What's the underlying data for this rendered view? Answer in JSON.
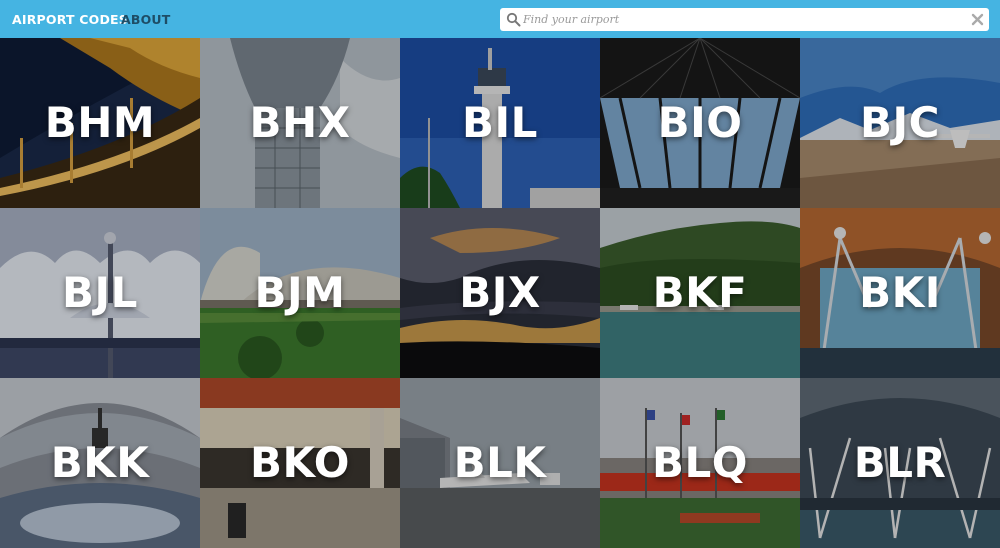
{
  "nav": {
    "home_label": "AIRPORT CODES",
    "about_label": "ABOUT"
  },
  "search": {
    "placeholder": "Find your airport",
    "icon": "magnifier-icon",
    "clear_icon": "clear-x-icon"
  },
  "colors": {
    "header": "#45b4e2",
    "about_link": "#1e4d66"
  },
  "airports": [
    {
      "code": "BHM"
    },
    {
      "code": "BHX"
    },
    {
      "code": "BIL"
    },
    {
      "code": "BIO"
    },
    {
      "code": "BJC"
    },
    {
      "code": "BJL"
    },
    {
      "code": "BJM"
    },
    {
      "code": "BJX"
    },
    {
      "code": "BKF"
    },
    {
      "code": "BKI"
    },
    {
      "code": "BKK"
    },
    {
      "code": "BKO"
    },
    {
      "code": "BLK"
    },
    {
      "code": "BLQ"
    },
    {
      "code": "BLR"
    }
  ]
}
